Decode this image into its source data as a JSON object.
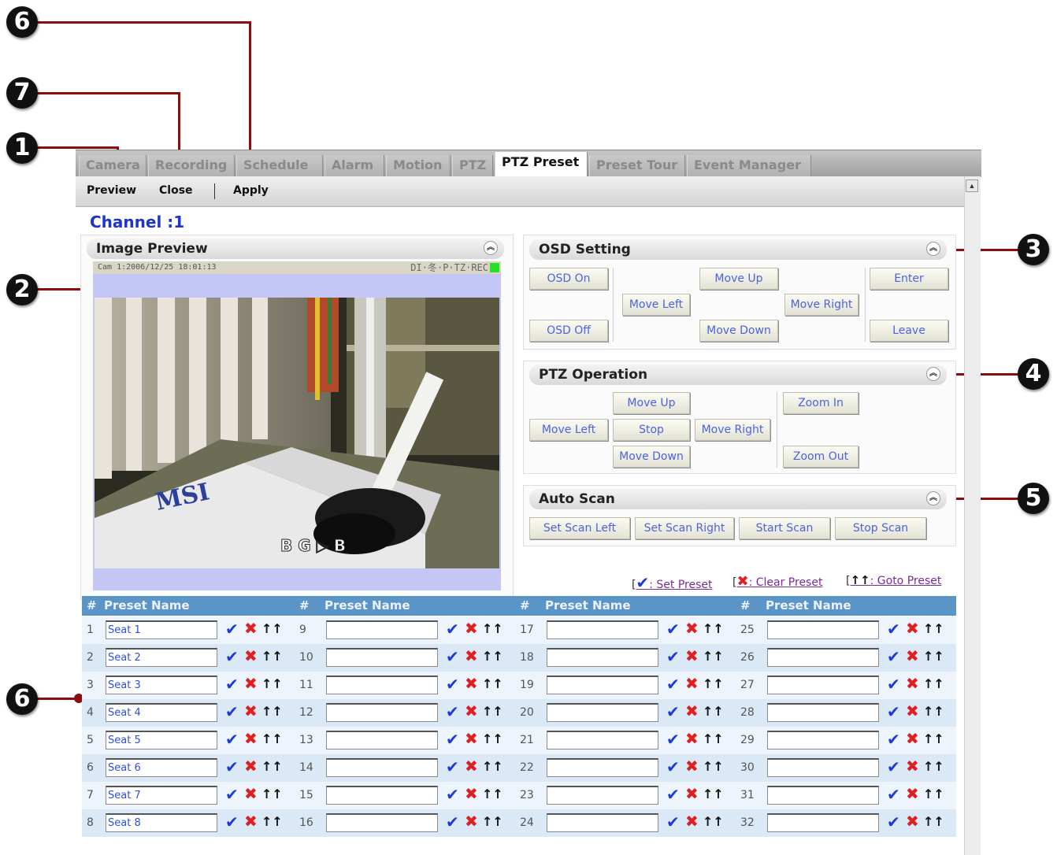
{
  "tabs": [
    "Camera",
    "Recording",
    "Schedule",
    "Alarm",
    "Motion",
    "PTZ",
    "PTZ Preset",
    "Preset Tour",
    "Event Manager"
  ],
  "active_tab": "PTZ Preset",
  "toolbar": {
    "preview": "Preview",
    "close": "Close",
    "apply": "Apply"
  },
  "channel": "Channel :1",
  "image_preview": {
    "title": "Image Preview",
    "cam_label": "Cam 1:2006/12/25 18:01:13",
    "status_flags": "DI·冬·P·TZ·REC",
    "overlay": "B G ▷ B",
    "brand_in_image": "MSI"
  },
  "osd": {
    "title": "OSD Setting",
    "buttons": {
      "osd_on": "OSD On",
      "osd_off": "OSD Off",
      "move_up": "Move Up",
      "move_left": "Move Left",
      "move_right": "Move Right",
      "move_down": "Move Down",
      "enter": "Enter",
      "leave": "Leave"
    }
  },
  "ptz": {
    "title": "PTZ Operation",
    "buttons": {
      "move_up": "Move Up",
      "move_left": "Move Left",
      "stop": "Stop",
      "move_right": "Move Right",
      "move_down": "Move Down",
      "zoom_in": "Zoom In",
      "zoom_out": "Zoom Out"
    }
  },
  "auto_scan": {
    "title": "Auto Scan",
    "buttons": {
      "set_left": "Set Scan Left",
      "set_right": "Set Scan Right",
      "start": "Start Scan",
      "stop": "Stop Scan"
    }
  },
  "legend": {
    "set": ": Set Preset",
    "clear": ": Clear Preset",
    "goto": ": Goto Preset"
  },
  "table": {
    "header_num": "#",
    "header_name": "Preset Name",
    "presets": [
      {
        "n": "1",
        "name": "Seat 1"
      },
      {
        "n": "2",
        "name": "Seat 2"
      },
      {
        "n": "3",
        "name": "Seat 3"
      },
      {
        "n": "4",
        "name": "Seat 4"
      },
      {
        "n": "5",
        "name": "Seat 5"
      },
      {
        "n": "6",
        "name": "Seat 6"
      },
      {
        "n": "7",
        "name": "Seat 7"
      },
      {
        "n": "8",
        "name": "Seat 8"
      },
      {
        "n": "9",
        "name": ""
      },
      {
        "n": "10",
        "name": ""
      },
      {
        "n": "11",
        "name": ""
      },
      {
        "n": "12",
        "name": ""
      },
      {
        "n": "13",
        "name": ""
      },
      {
        "n": "14",
        "name": ""
      },
      {
        "n": "15",
        "name": ""
      },
      {
        "n": "16",
        "name": ""
      },
      {
        "n": "17",
        "name": ""
      },
      {
        "n": "18",
        "name": ""
      },
      {
        "n": "19",
        "name": ""
      },
      {
        "n": "20",
        "name": ""
      },
      {
        "n": "21",
        "name": ""
      },
      {
        "n": "22",
        "name": ""
      },
      {
        "n": "23",
        "name": ""
      },
      {
        "n": "24",
        "name": ""
      },
      {
        "n": "25",
        "name": ""
      },
      {
        "n": "26",
        "name": ""
      },
      {
        "n": "27",
        "name": ""
      },
      {
        "n": "28",
        "name": ""
      },
      {
        "n": "29",
        "name": ""
      },
      {
        "n": "30",
        "name": ""
      },
      {
        "n": "31",
        "name": ""
      },
      {
        "n": "32",
        "name": ""
      }
    ]
  },
  "callouts": [
    "6",
    "7",
    "1",
    "2",
    "3",
    "4",
    "5",
    "6"
  ],
  "icons": {
    "set": "checkmark-icon",
    "clear": "x-icon",
    "goto": "goto-arrows-icon",
    "collapse": "chevron-up-icon"
  },
  "colors": {
    "accent_text": "#1d35c8",
    "button_text": "#4b63e0",
    "table_header": "#5b94c6",
    "callout_line": "#8b0d0d",
    "clear_icon": "#e02020",
    "set_icon": "#1a3bd8"
  }
}
